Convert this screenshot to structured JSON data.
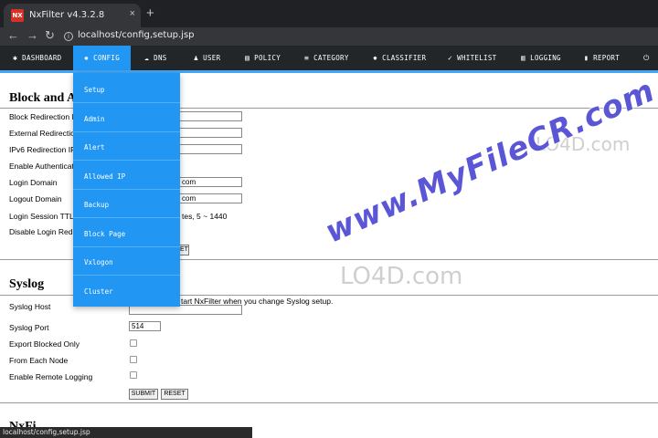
{
  "browser": {
    "tab_title": "NxFilter v4.3.2.8",
    "favicon_text": "NX",
    "close_glyph": "×",
    "new_tab_glyph": "+",
    "back_glyph": "←",
    "forward_glyph": "→",
    "reload_glyph": "↻",
    "url_info_glyph": "i",
    "url": "localhost/config,setup.jsp"
  },
  "nav": {
    "items": [
      {
        "label": "DASHBOARD",
        "icon": "dashboard-icon",
        "glyph": "✱"
      },
      {
        "label": "CONFIG",
        "icon": "gear-icon",
        "glyph": "✹"
      },
      {
        "label": "DNS",
        "icon": "cloud-icon",
        "glyph": "☁"
      },
      {
        "label": "USER",
        "icon": "user-icon",
        "glyph": "♟"
      },
      {
        "label": "POLICY",
        "icon": "document-icon",
        "glyph": "▤"
      },
      {
        "label": "CATEGORY",
        "icon": "list-icon",
        "glyph": "≡"
      },
      {
        "label": "CLASSIFIER",
        "icon": "bug-icon",
        "glyph": "✸"
      },
      {
        "label": "WHITELIST",
        "icon": "check-circle-icon",
        "glyph": "✓"
      },
      {
        "label": "LOGGING",
        "icon": "log-icon",
        "glyph": "▥"
      },
      {
        "label": "REPORT",
        "icon": "chart-icon",
        "glyph": "▮"
      },
      {
        "label": "",
        "icon": "power-icon",
        "glyph": "⏻"
      }
    ],
    "active": "CONFIG",
    "accent_color": "#2196f3"
  },
  "dropdown": {
    "items": [
      "Setup",
      "Admin",
      "Alert",
      "Allowed IP",
      "Backup",
      "Block Page",
      "Vxlogon",
      "Cluster"
    ]
  },
  "block_section": {
    "title": "Block and Au",
    "fields": [
      {
        "label": "Block Redirection I",
        "value": ""
      },
      {
        "label": "External Redirectio",
        "value": ""
      },
      {
        "label": "IPv6 Redirection IF",
        "value": ""
      },
      {
        "label": "Enable Authenticat",
        "value": ""
      },
      {
        "label": "Login Domain",
        "value": "com"
      },
      {
        "label": "Logout Domain",
        "value": "com"
      },
      {
        "label": "Login Session TTL",
        "value": ""
      },
      {
        "label": "Disable Login Redi",
        "value": ""
      }
    ],
    "ttl_hint": "tes, 5 ~ 1440",
    "reset_fragment": "ET"
  },
  "syslog": {
    "title": "Syslog",
    "host_label": "Syslog Host",
    "host_hint": "tart NxFilter when you change Syslog setup.",
    "host_value": "",
    "port_label": "Syslog Port",
    "port_value": "514",
    "checks": [
      {
        "label": "Export Blocked Only",
        "checked": false
      },
      {
        "label": "From Each Node",
        "checked": false
      },
      {
        "label": "Enable Remote Logging",
        "checked": false
      }
    ],
    "submit_label": "SUBMIT",
    "reset_label": "RESET"
  },
  "next_section_fragment": "NxFi",
  "statusbar": "localhost/config,setup.jsp",
  "watermarks": {
    "myfilecr": "www.MyFileCR.com",
    "lo4d": "LO4D.com"
  }
}
